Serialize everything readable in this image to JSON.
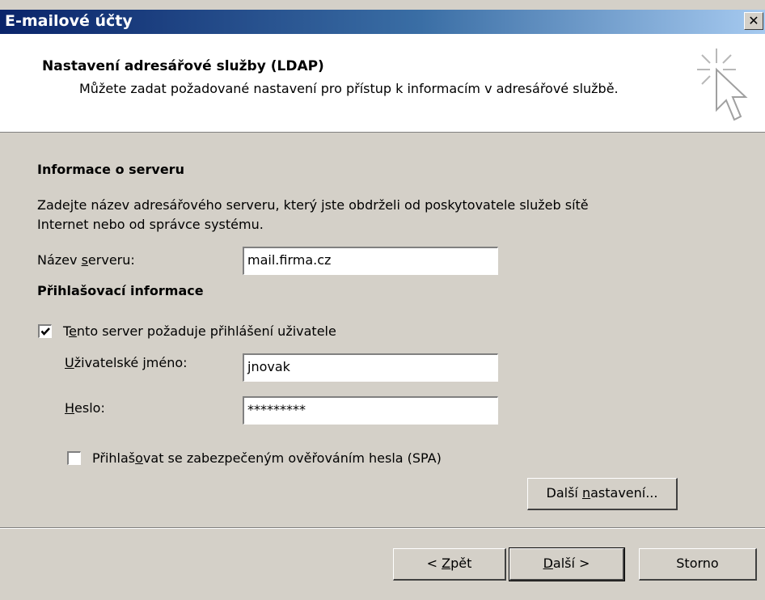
{
  "window": {
    "title": "E-mailové účty",
    "close_glyph": "✕"
  },
  "header": {
    "title": "Nastavení adresářové služby (LDAP)",
    "subtitle": "Můžete zadat požadované nastavení pro přístup k informacím v adresářové službě.",
    "icon": "wizard-cursor-icon"
  },
  "server_info": {
    "heading": "Informace o serveru",
    "description_line1": "Zadejte název adresářového serveru, který jste obdrželi od poskytovatele služeb sítě",
    "description_line2": "Internet nebo od správce systému.",
    "server_label_pre": "Název ",
    "server_label_key": "s",
    "server_label_post": "erveru:",
    "server_value": "mail.firma.cz"
  },
  "login_info": {
    "heading": "Přihlašovací informace",
    "requires_login_pre": "T",
    "requires_login_key": "e",
    "requires_login_post": "nto server požaduje přihlášení uživatele",
    "requires_login_checked": true,
    "username_label_key": "U",
    "username_label_post": "živatelské jméno:",
    "username_value": "jnovak",
    "password_label_key": "H",
    "password_label_post": "eslo:",
    "password_value": "*********",
    "spa_pre": "Přihlaš",
    "spa_key": "o",
    "spa_post": "vat se zabezpečeným ověřováním hesla (SPA)",
    "spa_checked": false,
    "more_settings_pre": "Další ",
    "more_settings_key": "n",
    "more_settings_post": "astavení..."
  },
  "footer": {
    "back_pre": "< ",
    "back_key": "Z",
    "back_post": "pět",
    "next_key": "D",
    "next_post": "alší >",
    "cancel": "Storno"
  }
}
